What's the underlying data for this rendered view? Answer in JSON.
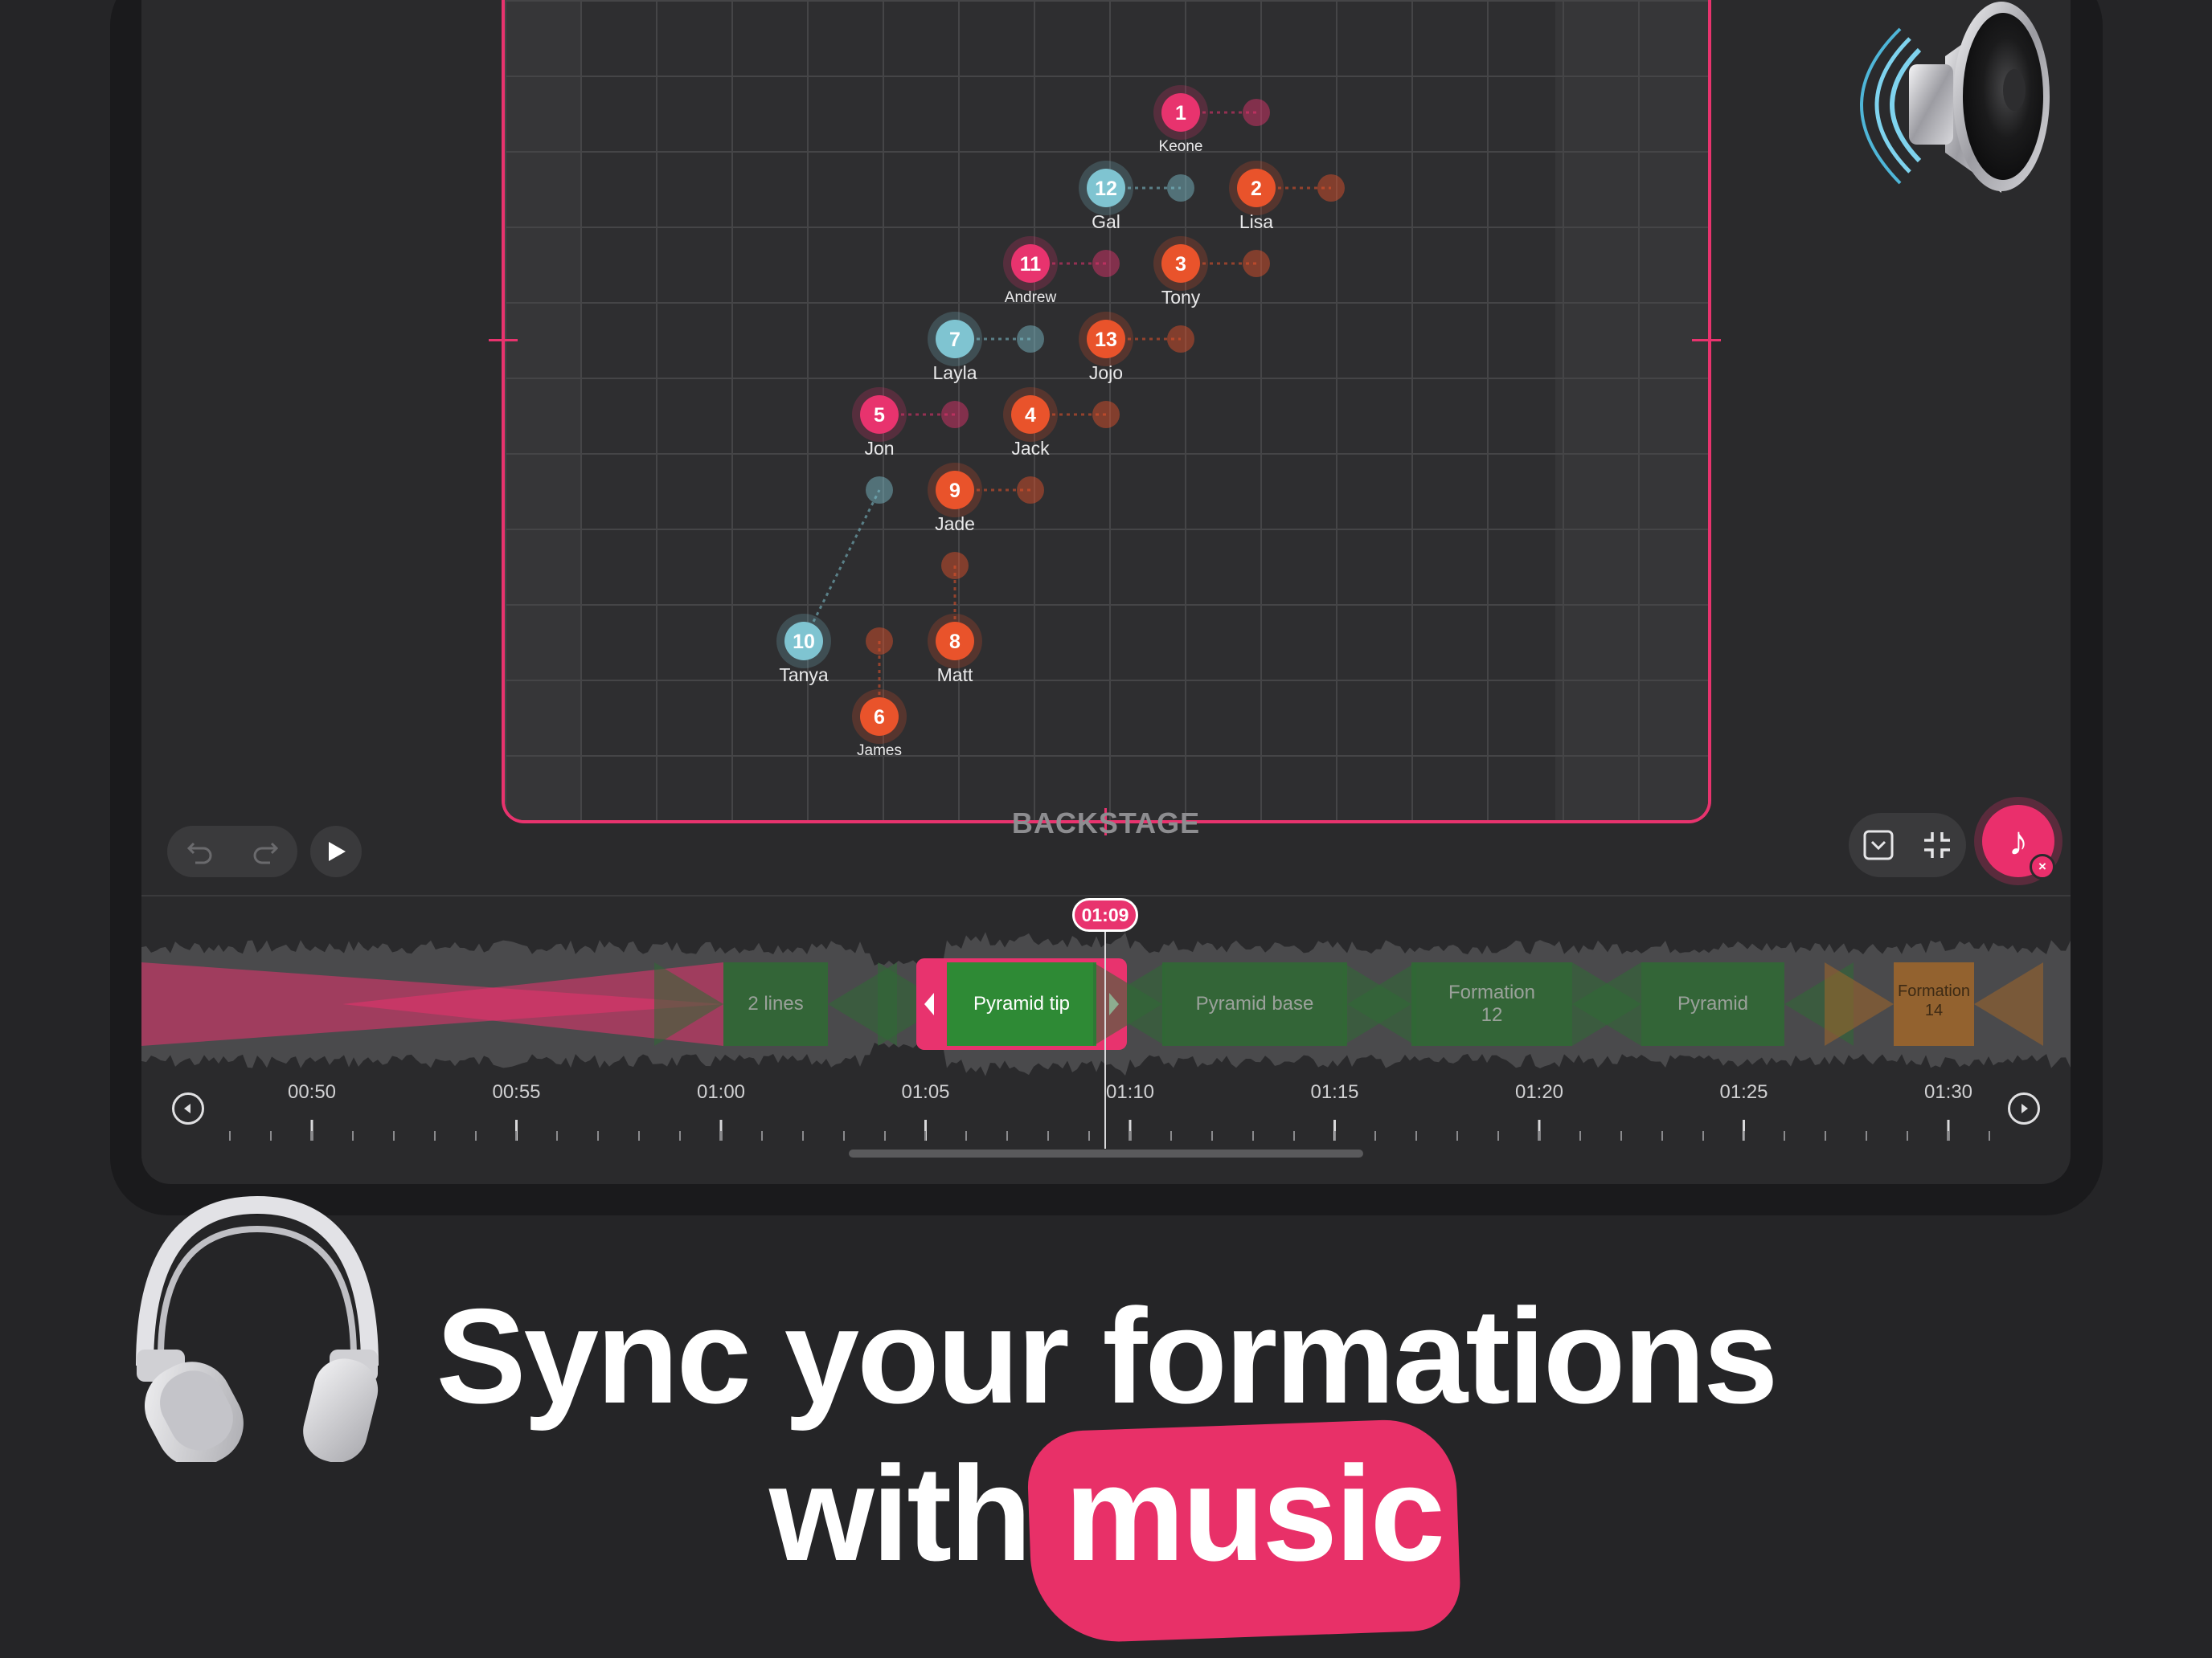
{
  "stage": {
    "bottom_label": "BACKSTAGE"
  },
  "dancers": [
    {
      "num": "1",
      "name": "Keone",
      "color": "pink"
    },
    {
      "num": "12",
      "name": "Gal",
      "color": "teal"
    },
    {
      "num": "2",
      "name": "Lisa",
      "color": "orange"
    },
    {
      "num": "11",
      "name": "Andrew",
      "color": "pink"
    },
    {
      "num": "3",
      "name": "Tony",
      "color": "orange"
    },
    {
      "num": "7",
      "name": "Layla",
      "color": "teal"
    },
    {
      "num": "13",
      "name": "Jojo",
      "color": "orange"
    },
    {
      "num": "5",
      "name": "Jon",
      "color": "pink"
    },
    {
      "num": "4",
      "name": "Jack",
      "color": "orange"
    },
    {
      "num": "9",
      "name": "Jade",
      "color": "orange"
    },
    {
      "num": "10",
      "name": "Tanya",
      "color": "teal"
    },
    {
      "num": "8",
      "name": "Matt",
      "color": "orange"
    },
    {
      "num": "6",
      "name": "James",
      "color": "orange"
    }
  ],
  "colors": {
    "accent": "#e8336e",
    "pink": "#e8336e",
    "orange": "#e9532b",
    "teal": "#7fc4d1",
    "clip_green": "#2f6a34",
    "clip_orange": "#a0662a"
  },
  "toolbar": {
    "undo_icon": "undo-icon",
    "redo_icon": "redo-icon",
    "play_icon": "play-icon",
    "collapse_icon": "collapse-icon",
    "fullscreen_exit_icon": "compress-icon",
    "music_icon": "music-note-icon"
  },
  "timeline": {
    "current_time": "01:09",
    "clips": [
      {
        "label": "2 lines"
      },
      {
        "label": "Pyramid tip",
        "selected": true
      },
      {
        "label": "Pyramid base"
      },
      {
        "label": "Formation\n12"
      },
      {
        "label": "Pyramid"
      },
      {
        "label": "Formation\n14"
      }
    ],
    "ruler_labels": [
      "00:50",
      "00:55",
      "01:00",
      "01:05",
      "01:10",
      "01:15",
      "01:20",
      "01:25",
      "01:30"
    ]
  },
  "headline": {
    "line1": "Sync your formations",
    "line2_prefix": "with ",
    "line2_highlight": "music"
  }
}
